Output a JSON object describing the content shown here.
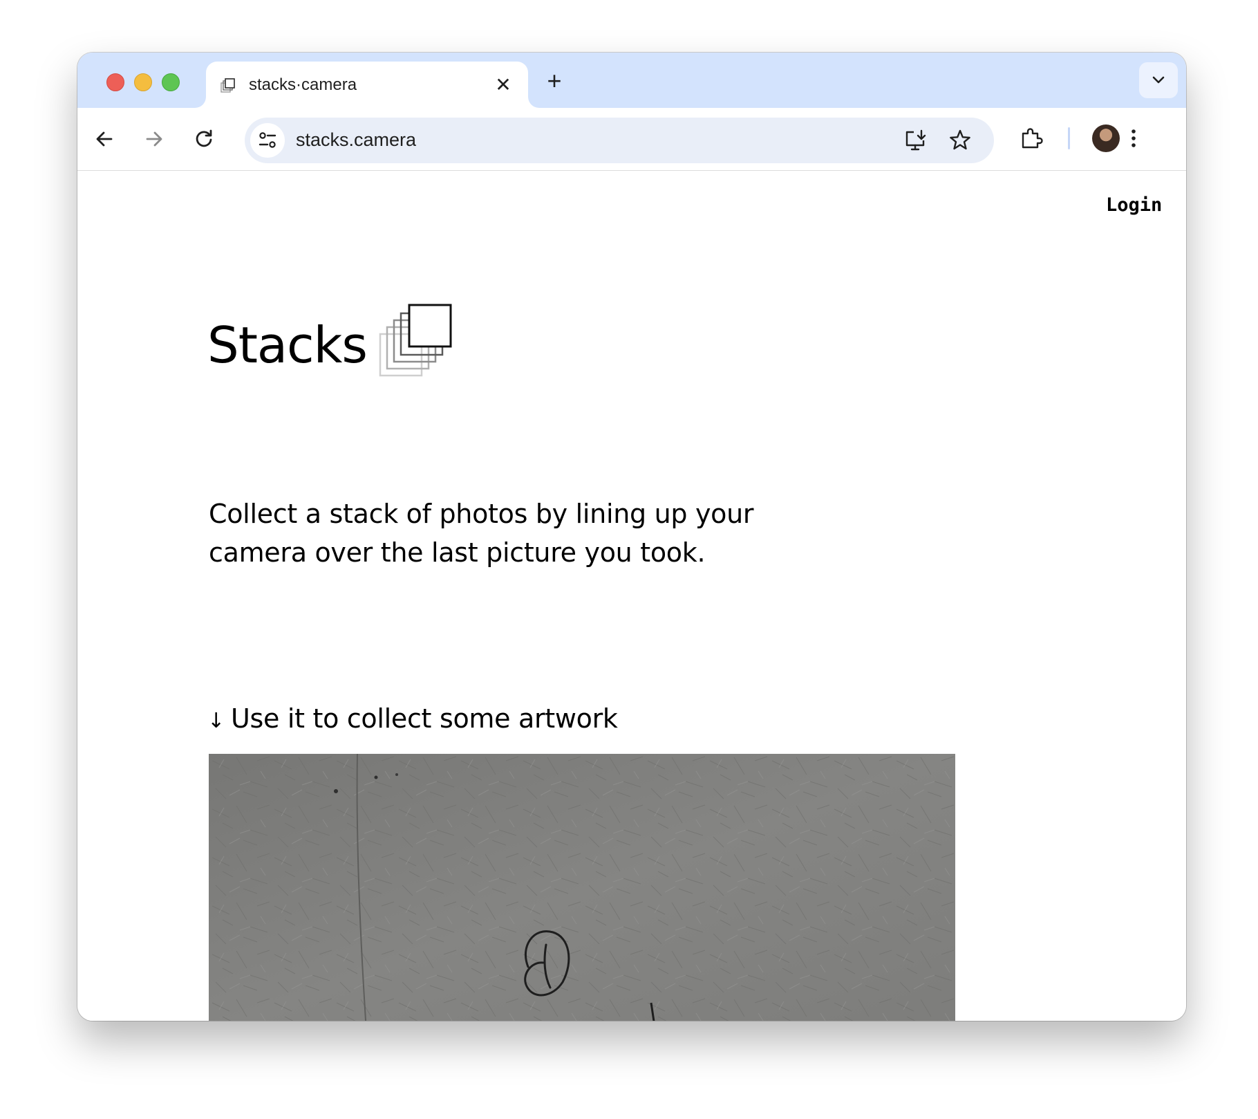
{
  "browser": {
    "tab": {
      "title": "stacks·camera",
      "close_glyph": "✕"
    },
    "new_tab_glyph": "+",
    "address_bar": {
      "url": "stacks.camera"
    },
    "icons": {
      "back": "arrow-left-icon",
      "forward": "arrow-right-icon",
      "reload": "reload-icon",
      "site_info": "tune-icon",
      "install": "install-app-icon",
      "bookmark": "star-icon",
      "extensions": "puzzle-icon",
      "menu": "kebab-menu-icon",
      "tab_search": "chevron-down-icon"
    },
    "colors": {
      "tabstrip": "#d3e3fd",
      "omnibox": "#e9eef8"
    }
  },
  "page": {
    "login_label": "Login",
    "brand_name": "Stacks",
    "tagline": "Collect a stack of photos by lining up your camera over the last picture you took.",
    "section": {
      "arrow": "↓",
      "heading": "Use it to collect some artwork"
    }
  }
}
